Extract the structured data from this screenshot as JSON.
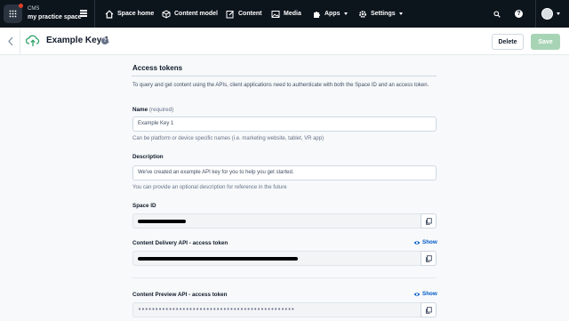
{
  "topnav": {
    "org_name": "CMS",
    "space_name": "my practice space",
    "items": [
      {
        "label": "Space home",
        "icon": "home-icon"
      },
      {
        "label": "Content model",
        "icon": "cube-icon"
      },
      {
        "label": "Content",
        "icon": "edit-icon"
      },
      {
        "label": "Media",
        "icon": "image-icon"
      },
      {
        "label": "Apps",
        "icon": "puzzle-icon"
      },
      {
        "label": "Settings",
        "icon": "gear-icon"
      }
    ],
    "help_glyph": "?"
  },
  "header": {
    "title": "Example Key 1",
    "help_glyph": "?",
    "delete_label": "Delete",
    "save_label": "Save"
  },
  "form": {
    "section_title": "Access tokens",
    "intro": "To query and get content using the APIs, client applications need to authenticate with both the Space ID and an access token.",
    "name_label": "Name",
    "name_required": "(required)",
    "name_value": "Example Key 1",
    "name_help": "Can be platform or device specific names (i.e. marketing website, tablet, VR app)",
    "description_label": "Description",
    "description_value": "We've created an example API key for you to help you get started.",
    "description_help": "You can provide an optional description for reference in the future",
    "space_id_label": "Space ID",
    "cda_label": "Content Delivery API - access token",
    "cda_show": "Show",
    "cpa_label": "Content Preview API - access token",
    "cpa_show": "Show",
    "cpa_masked": "••••••••••••••••••••••••••••••••••••••••••••••"
  },
  "colors": {
    "topbar": "#0c141c",
    "accent_link": "#0059c8",
    "save_disabled": "#a8d4b6",
    "notification": "#e2412c"
  }
}
